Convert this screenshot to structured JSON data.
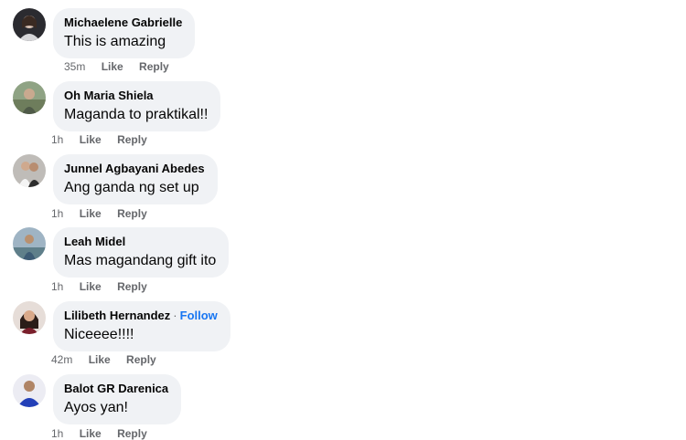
{
  "comments": [
    {
      "author": "Michaelene Gabrielle",
      "text": "This is amazing",
      "time": "35m",
      "like": "Like",
      "reply": "Reply",
      "follow": ""
    },
    {
      "author": "Oh Maria Shiela",
      "text": "Maganda to praktikal!!",
      "time": "1h",
      "like": "Like",
      "reply": "Reply",
      "follow": ""
    },
    {
      "author": "Junnel Agbayani Abedes",
      "text": "Ang ganda ng set up",
      "time": "1h",
      "like": "Like",
      "reply": "Reply",
      "follow": ""
    },
    {
      "author": "Leah Midel",
      "text": "Mas magandang gift ito",
      "time": "1h",
      "like": "Like",
      "reply": "Reply",
      "follow": ""
    },
    {
      "author": "Lilibeth Hernandez",
      "text": "Niceeee!!!!",
      "time": "42m",
      "like": "Like",
      "reply": "Reply",
      "follow": "Follow"
    },
    {
      "author": "Balot GR Darenica",
      "text": "Ayos yan!",
      "time": "1h",
      "like": "Like",
      "reply": "Reply",
      "follow": ""
    }
  ],
  "colors": {
    "bubble": "#f0f2f5",
    "link": "#1876f2",
    "meta": "#65676b",
    "text": "#050505"
  }
}
